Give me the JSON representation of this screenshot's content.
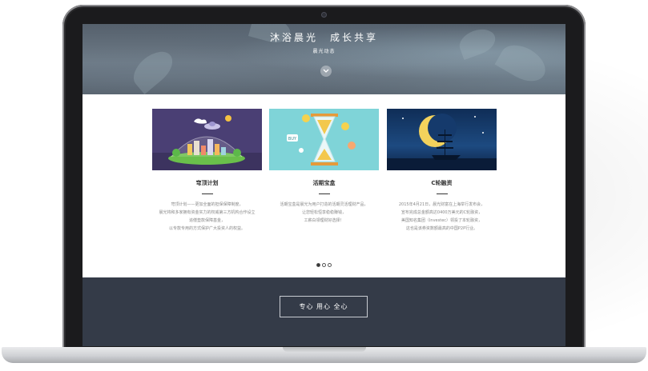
{
  "hero": {
    "title": "沐浴晨光　成长共享",
    "subtitle": "晨光动态",
    "scroll_icon": "chevron-down-icon"
  },
  "cards": [
    {
      "title": "穹顶计划",
      "desc": [
        "穹顶计划——更加全面的担保保障制度，",
        "晨光将和多家拥有资金实力的权威第三方机构合作设立",
        "追偿垫款保障基金，",
        "以专款专用的方式保护广大投资人的权益。"
      ]
    },
    {
      "title": "活期宝盒",
      "desc": [
        "活期宝盒是晨光为用户打造的活期灵活理财产品，",
        "让您轻松恒享稳稳赚钱，",
        "工薪白领理财好选择！"
      ]
    },
    {
      "title": "C轮融资",
      "desc": [
        "2015年4月21日，晨光财富在上海举行发布会，",
        "宣布完成总金额高达0400万美元的C轮融资，",
        "美国知名集团（Investec）领投了本轮融资，",
        "这也是该券资数额最高的中国P2P行业。"
      ]
    }
  ],
  "pagination": {
    "count": 3,
    "active": 1
  },
  "footer": {
    "cta_label": "专心 用心 全心"
  },
  "colors": {
    "footer_bg": "#343b48",
    "hero_bg": "#5f6b77",
    "card1_bg": "#4a3f74",
    "card2_bg": "#7fd4d8",
    "card3_bg": "#14345e"
  }
}
